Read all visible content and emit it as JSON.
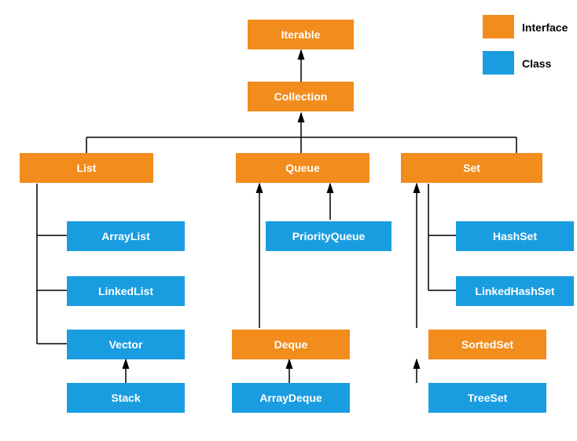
{
  "legend": {
    "interface": "Interface",
    "class": "Class"
  },
  "nodes": {
    "iterable": "Iterable",
    "collection": "Collection",
    "list": "List",
    "queue": "Queue",
    "set": "Set",
    "arraylist": "ArrayList",
    "linkedlist": "LinkedList",
    "vector": "Vector",
    "stack": "Stack",
    "priorityqueue": "PriorityQueue",
    "deque": "Deque",
    "arraydeque": "ArrayDeque",
    "hashset": "HashSet",
    "linkedhashset": "LinkedHashSet",
    "sortedset": "SortedSet",
    "treeset": "TreeSet"
  },
  "colors": {
    "interface": "#f28c1c",
    "class": "#1a9de0"
  },
  "chart_data": {
    "type": "diagram",
    "title": "Java Collection Framework Hierarchy",
    "node_types": {
      "interface": "#f28c1c",
      "class": "#1a9de0"
    },
    "nodes": [
      {
        "id": "Iterable",
        "type": "interface"
      },
      {
        "id": "Collection",
        "type": "interface"
      },
      {
        "id": "List",
        "type": "interface"
      },
      {
        "id": "Queue",
        "type": "interface"
      },
      {
        "id": "Set",
        "type": "interface"
      },
      {
        "id": "ArrayList",
        "type": "class"
      },
      {
        "id": "LinkedList",
        "type": "class"
      },
      {
        "id": "Vector",
        "type": "class"
      },
      {
        "id": "Stack",
        "type": "class"
      },
      {
        "id": "PriorityQueue",
        "type": "class"
      },
      {
        "id": "Deque",
        "type": "interface"
      },
      {
        "id": "ArrayDeque",
        "type": "class"
      },
      {
        "id": "HashSet",
        "type": "class"
      },
      {
        "id": "LinkedHashSet",
        "type": "class"
      },
      {
        "id": "SortedSet",
        "type": "interface"
      },
      {
        "id": "TreeSet",
        "type": "class"
      }
    ],
    "edges": [
      {
        "from": "Collection",
        "to": "Iterable"
      },
      {
        "from": "List",
        "to": "Collection"
      },
      {
        "from": "Queue",
        "to": "Collection"
      },
      {
        "from": "Set",
        "to": "Collection"
      },
      {
        "from": "ArrayList",
        "to": "List"
      },
      {
        "from": "LinkedList",
        "to": "List"
      },
      {
        "from": "Vector",
        "to": "List"
      },
      {
        "from": "Stack",
        "to": "Vector"
      },
      {
        "from": "PriorityQueue",
        "to": "Queue"
      },
      {
        "from": "Deque",
        "to": "Queue"
      },
      {
        "from": "ArrayDeque",
        "to": "Deque"
      },
      {
        "from": "HashSet",
        "to": "Set"
      },
      {
        "from": "LinkedHashSet",
        "to": "Set"
      },
      {
        "from": "SortedSet",
        "to": "Set"
      },
      {
        "from": "TreeSet",
        "to": "SortedSet"
      }
    ]
  }
}
